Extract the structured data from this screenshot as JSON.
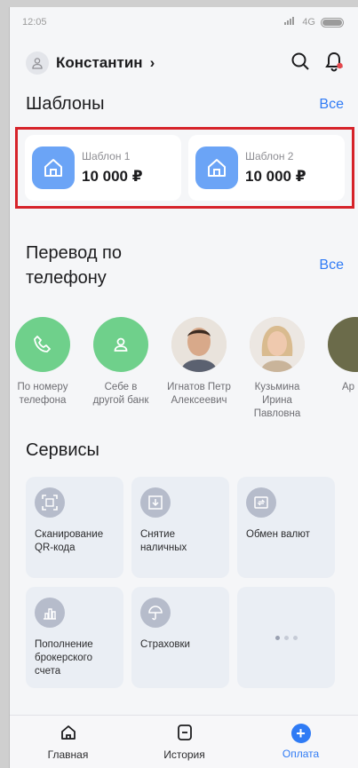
{
  "status": {
    "time": "12:05",
    "network": "4G"
  },
  "header": {
    "user_name": "Константин",
    "chevron": "›"
  },
  "templates": {
    "title": "Шаблоны",
    "all_label": "Все",
    "items": [
      {
        "name": "Шаблон 1",
        "amount": "10 000 ₽"
      },
      {
        "name": "Шаблон 2",
        "amount": "10 000 ₽"
      }
    ]
  },
  "transfer": {
    "title": "Перевод по телефону",
    "all_label": "Все",
    "contacts": [
      {
        "label": "По номеру телефона",
        "icon": "phone-icon"
      },
      {
        "label": "Себе в другой банк",
        "icon": "person-icon"
      },
      {
        "label": "Игнатов Петр Алексеевич",
        "icon": "photo"
      },
      {
        "label": "Кузьмина Ирина Павловна",
        "icon": "photo"
      },
      {
        "label": "Ар ре",
        "icon": "photo"
      }
    ]
  },
  "services": {
    "title": "Сервисы",
    "items": [
      {
        "label": "Сканирование QR-кода",
        "icon": "qr-scan-icon"
      },
      {
        "label": "Снятие наличных",
        "icon": "cash-withdraw-icon"
      },
      {
        "label": "Обмен валют",
        "icon": "currency-exchange-icon"
      },
      {
        "label": "Пополнение брокерского счета",
        "icon": "chart-icon"
      },
      {
        "label": "Страховки",
        "icon": "umbrella-icon"
      }
    ]
  },
  "tabbar": {
    "tabs": [
      {
        "label": "Главная",
        "icon": "home-icon"
      },
      {
        "label": "История",
        "icon": "history-icon"
      },
      {
        "label": "Оплата",
        "icon": "plus-icon"
      }
    ],
    "active": "Оплата"
  },
  "colors": {
    "accent": "#2f7bf5",
    "highlight_border": "#d6232a",
    "template_icon_bg": "#6ba4f6",
    "contact_green": "#6fd08b"
  }
}
